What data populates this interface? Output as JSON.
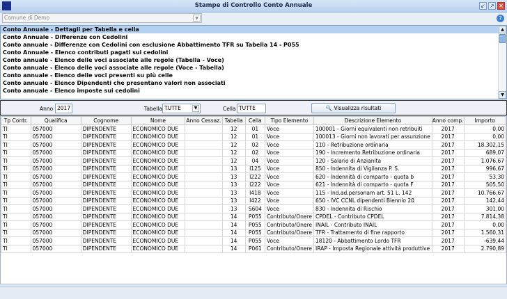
{
  "window": {
    "title": "Stampe di Controllo Conto Annuale",
    "minimize": "↙",
    "maximize": "↗",
    "close": "✕"
  },
  "entity_combo": {
    "value": "Comune di Demo"
  },
  "reports": [
    "Conto Annuale - Dettagli per Tabella e cella",
    "Conto Annuale - Differenze con Cedolini",
    "Conto annuale - Differenze con Cedolini con esclusione Abbattimento TFR su Tabella 14 - P055",
    "Conto Annuale - Elenco contributi pagati sui cedolini",
    "Conto annuale - Elenco delle voci associate alle regole (Tabella - Voce)",
    "Conto annuale - Elenco delle voci associate alle regole (Voce - Tabella)",
    "Conto annuale - Elenco delle voci presenti su più celle",
    "Conto annuale - Elenco Dipendenti che presentano valori non associati",
    "Conto annuale - Elenco imposte sui cedolini"
  ],
  "filters": {
    "anno_label": "Anno",
    "anno": "2017",
    "tabella_label": "Tabella",
    "tabella": "TUTTE",
    "cella_label": "Cella",
    "cella": "TUTTE",
    "button": "Visualizza risultati"
  },
  "columns": [
    "Tp Contr.",
    "Qualifica",
    "Cognome",
    "Nome",
    "Anno Cessaz.",
    "Tabella",
    "Cella",
    "Tipo Elemento",
    "Descrizione Elemento",
    "Anno comp.",
    "Importo"
  ],
  "rows": [
    [
      "TI",
      "057000",
      "DIPENDENTE",
      "ECONOMICO DUE",
      "",
      "12",
      "01",
      "Voce",
      "100001 - Giorni equivalenti non retribuiti",
      "2017",
      "0,00"
    ],
    [
      "TI",
      "057000",
      "DIPENDENTE",
      "ECONOMICO DUE",
      "",
      "12",
      "01",
      "Voce",
      "100013 - Giorni non lavorati per assunzione",
      "2017",
      "0,00"
    ],
    [
      "TI",
      "057000",
      "DIPENDENTE",
      "ECONOMICO DUE",
      "",
      "12",
      "02",
      "Voce",
      "110 - Retribuzione ordinaria",
      "2017",
      "18.302,15"
    ],
    [
      "TI",
      "057000",
      "DIPENDENTE",
      "ECONOMICO DUE",
      "",
      "12",
      "02",
      "Voce",
      "190 - Incremento Retribuzione ordinaria",
      "2017",
      "689,07"
    ],
    [
      "TI",
      "057000",
      "DIPENDENTE",
      "ECONOMICO DUE",
      "",
      "12",
      "04",
      "Voce",
      "120 - Salario di Anzianita",
      "2017",
      "1.076,67"
    ],
    [
      "TI",
      "057000",
      "DIPENDENTE",
      "ECONOMICO DUE",
      "",
      "13",
      "I125",
      "Voce",
      "850 - Indennita di Vigilanza P. S.",
      "2017",
      "996,67"
    ],
    [
      "TI",
      "057000",
      "DIPENDENTE",
      "ECONOMICO DUE",
      "",
      "13",
      "I222",
      "Voce",
      "620 - Indennità di comparto - quota b",
      "2017",
      "53,30"
    ],
    [
      "TI",
      "057000",
      "DIPENDENTE",
      "ECONOMICO DUE",
      "",
      "13",
      "I222",
      "Voce",
      "621 - Indennità di comparto - quota F",
      "2017",
      "505,50"
    ],
    [
      "TI",
      "057000",
      "DIPENDENTE",
      "ECONOMICO DUE",
      "",
      "13",
      "I418",
      "Voce",
      "115 - Ind.ad.personam art. 51 L. 142",
      "2017",
      "10.766,67"
    ],
    [
      "TI",
      "057000",
      "DIPENDENTE",
      "ECONOMICO DUE",
      "",
      "13",
      "I422",
      "Voce",
      "650 - IVC CCNL dipendenti Biennio 20",
      "2017",
      "142,44"
    ],
    [
      "TI",
      "057000",
      "DIPENDENTE",
      "ECONOMICO DUE",
      "",
      "13",
      "S604",
      "Voce",
      "830 - Indennita di Rischio",
      "2017",
      "301,00"
    ],
    [
      "TI",
      "057000",
      "DIPENDENTE",
      "ECONOMICO DUE",
      "",
      "14",
      "P055",
      "Contributo/Onere",
      "CPDEL - Contributo CPDEL",
      "2017",
      "7.814,38"
    ],
    [
      "TI",
      "057000",
      "DIPENDENTE",
      "ECONOMICO DUE",
      "",
      "14",
      "P055",
      "Contributo/Onere",
      "INAIL - Contributo INAIL",
      "2017",
      "0,00"
    ],
    [
      "TI",
      "057000",
      "DIPENDENTE",
      "ECONOMICO DUE",
      "",
      "14",
      "P055",
      "Contributo/Onere",
      "TFR - Trattamento di fine rapporto",
      "2017",
      "1.560,31"
    ],
    [
      "TI",
      "057000",
      "DIPENDENTE",
      "ECONOMICO DUE",
      "",
      "14",
      "P055",
      "Voce",
      "18120 - Abbattimento Lordo TFR",
      "2017",
      "-639,44"
    ],
    [
      "TI",
      "057000",
      "DIPENDENTE",
      "ECONOMICO DUE",
      "",
      "14",
      "P061",
      "Contributo/Onere",
      "IRAP - Imposta Regionale attività produttive",
      "2017",
      "2.790,89"
    ]
  ]
}
